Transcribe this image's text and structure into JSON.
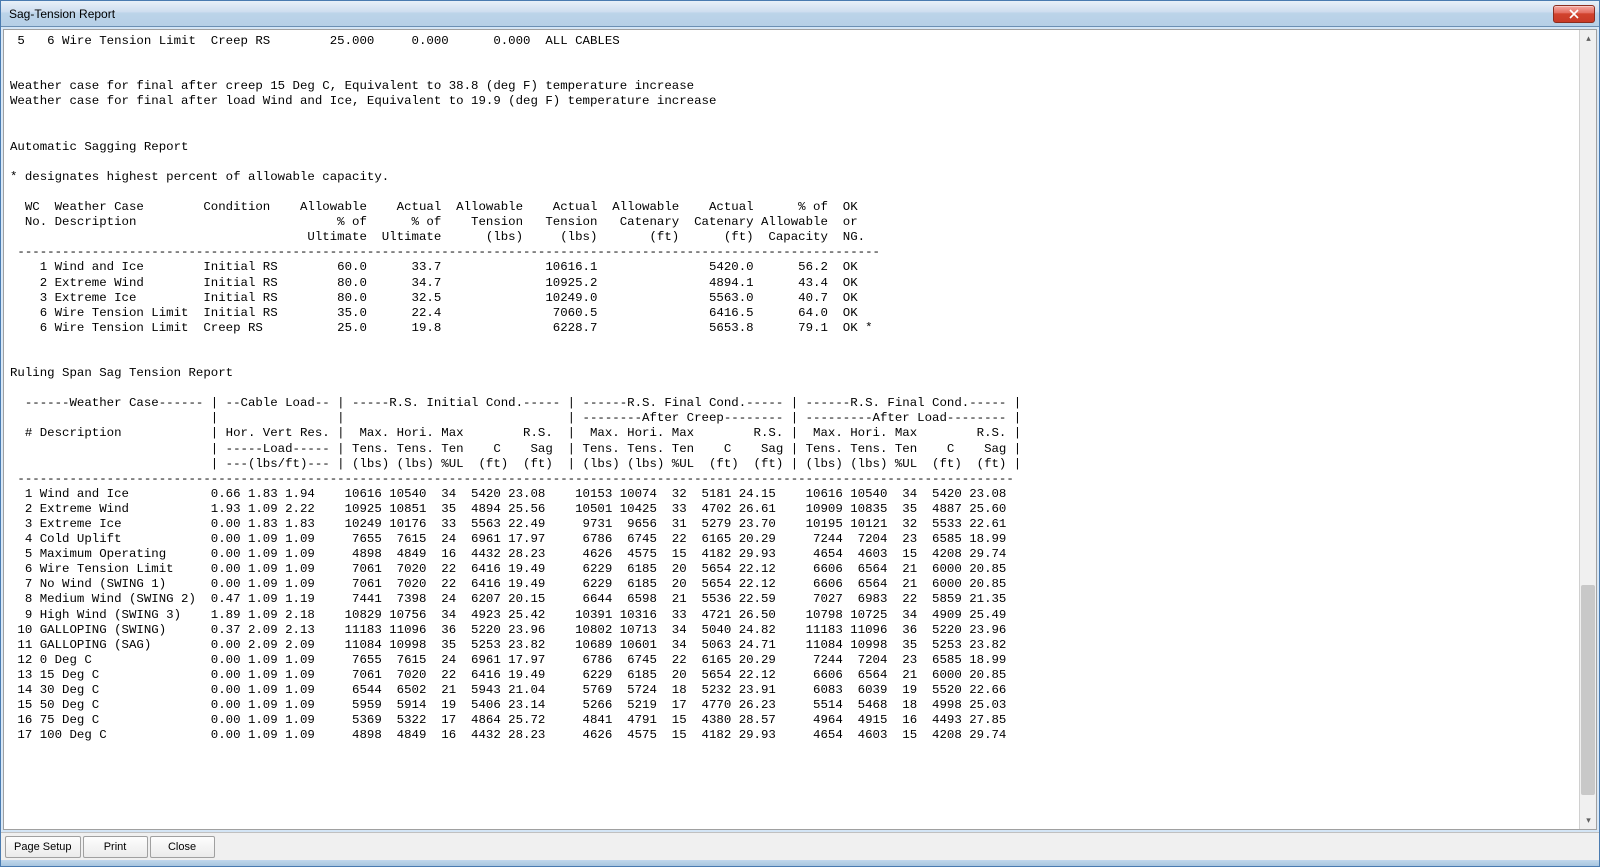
{
  "window": {
    "title": "Sag-Tension Report"
  },
  "buttons": {
    "page_setup": "Page Setup",
    "print": "Print",
    "close": "Close"
  },
  "report": {
    "top_line": " 5   6 Wire Tension Limit  Creep RS        25.000     0.000      0.000  ALL CABLES",
    "weather_notes": [
      "Weather case for final after creep 15 Deg C, Equivalent to 38.8 (deg F) temperature increase",
      "Weather case for final after load Wind and Ice, Equivalent to 19.9 (deg F) temperature increase"
    ],
    "section1_title": "Automatic Sagging Report",
    "section1_note": "* designates highest percent of allowable capacity.",
    "table1_headers": [
      "  WC  Weather Case        Condition    Allowable    Actual  Allowable    Actual  Allowable    Actual      % of  OK",
      "  No. Description                           % of      % of    Tension   Tension   Catenary  Catenary Allowable  or",
      "                                        Ultimate  Ultimate      (lbs)     (lbs)       (ft)      (ft)  Capacity  NG."
    ],
    "table1_divider": " --------------------------------------------------------------------------------------------------------------------",
    "table1_rows": [
      "    1 Wind and Ice        Initial RS        60.0      33.7              10616.1               5420.0      56.2  OK",
      "    2 Extreme Wind        Initial RS        80.0      34.7              10925.2               4894.1      43.4  OK",
      "    3 Extreme Ice         Initial RS        80.0      32.5              10249.0               5563.0      40.7  OK",
      "    6 Wire Tension Limit  Initial RS        35.0      22.4               7060.5               6416.5      64.0  OK",
      "    6 Wire Tension Limit  Creep RS          25.0      19.8               6228.7               5653.8      79.1  OK *"
    ],
    "section2_title": "Ruling Span Sag Tension Report",
    "table2_headers": [
      "  ------Weather Case------ | --Cable Load-- | -----R.S. Initial Cond.----- | ------R.S. Final Cond.----- | ------R.S. Final Cond.----- |",
      "                           |                |                              | --------After Creep-------- | ---------After Load-------- |",
      "  # Description            | Hor. Vert Res. |  Max. Hori. Max        R.S.  |  Max. Hori. Max        R.S. |  Max. Hori. Max        R.S. |",
      "                           | -----Load----- | Tens. Tens. Ten    C    Sag  | Tens. Tens. Ten    C    Sag | Tens. Tens. Ten    C    Sag |",
      "                           | ---(lbs/ft)--- | (lbs) (lbs) %UL  (ft)  (ft)  | (lbs) (lbs) %UL  (ft)  (ft) | (lbs) (lbs) %UL  (ft)  (ft) |"
    ],
    "table2_divider": " --------------------------------------------------------------------------------------------------------------------------------------",
    "table2_rows": [
      "  1 Wind and Ice           0.66 1.83 1.94    10616 10540  34  5420 23.08    10153 10074  32  5181 24.15    10616 10540  34  5420 23.08",
      "  2 Extreme Wind           1.93 1.09 2.22    10925 10851  35  4894 25.56    10501 10425  33  4702 26.61    10909 10835  35  4887 25.60",
      "  3 Extreme Ice            0.00 1.83 1.83    10249 10176  33  5563 22.49     9731  9656  31  5279 23.70    10195 10121  32  5533 22.61",
      "  4 Cold Uplift            0.00 1.09 1.09     7655  7615  24  6961 17.97     6786  6745  22  6165 20.29     7244  7204  23  6585 18.99",
      "  5 Maximum Operating      0.00 1.09 1.09     4898  4849  16  4432 28.23     4626  4575  15  4182 29.93     4654  4603  15  4208 29.74",
      "  6 Wire Tension Limit     0.00 1.09 1.09     7061  7020  22  6416 19.49     6229  6185  20  5654 22.12     6606  6564  21  6000 20.85",
      "  7 No Wind (SWING 1)      0.00 1.09 1.09     7061  7020  22  6416 19.49     6229  6185  20  5654 22.12     6606  6564  21  6000 20.85",
      "  8 Medium Wind (SWING 2)  0.47 1.09 1.19     7441  7398  24  6207 20.15     6644  6598  21  5536 22.59     7027  6983  22  5859 21.35",
      "  9 High Wind (SWING 3)    1.89 1.09 2.18    10829 10756  34  4923 25.42    10391 10316  33  4721 26.50    10798 10725  34  4909 25.49",
      " 10 GALLOPING (SWING)      0.37 2.09 2.13    11183 11096  36  5220 23.96    10802 10713  34  5040 24.82    11183 11096  36  5220 23.96",
      " 11 GALLOPING (SAG)        0.00 2.09 2.09    11084 10998  35  5253 23.82    10689 10601  34  5063 24.71    11084 10998  35  5253 23.82",
      " 12 0 Deg C                0.00 1.09 1.09     7655  7615  24  6961 17.97     6786  6745  22  6165 20.29     7244  7204  23  6585 18.99",
      " 13 15 Deg C               0.00 1.09 1.09     7061  7020  22  6416 19.49     6229  6185  20  5654 22.12     6606  6564  21  6000 20.85",
      " 14 30 Deg C               0.00 1.09 1.09     6544  6502  21  5943 21.04     5769  5724  18  5232 23.91     6083  6039  19  5520 22.66",
      " 15 50 Deg C               0.00 1.09 1.09     5959  5914  19  5406 23.14     5266  5219  17  4770 26.23     5514  5468  18  4998 25.03",
      " 16 75 Deg C               0.00 1.09 1.09     5369  5322  17  4864 25.72     4841  4791  15  4380 28.57     4964  4915  16  4493 27.85",
      " 17 100 Deg C              0.00 1.09 1.09     4898  4849  16  4432 28.23     4626  4575  15  4182 29.93     4654  4603  15  4208 29.74"
    ]
  }
}
